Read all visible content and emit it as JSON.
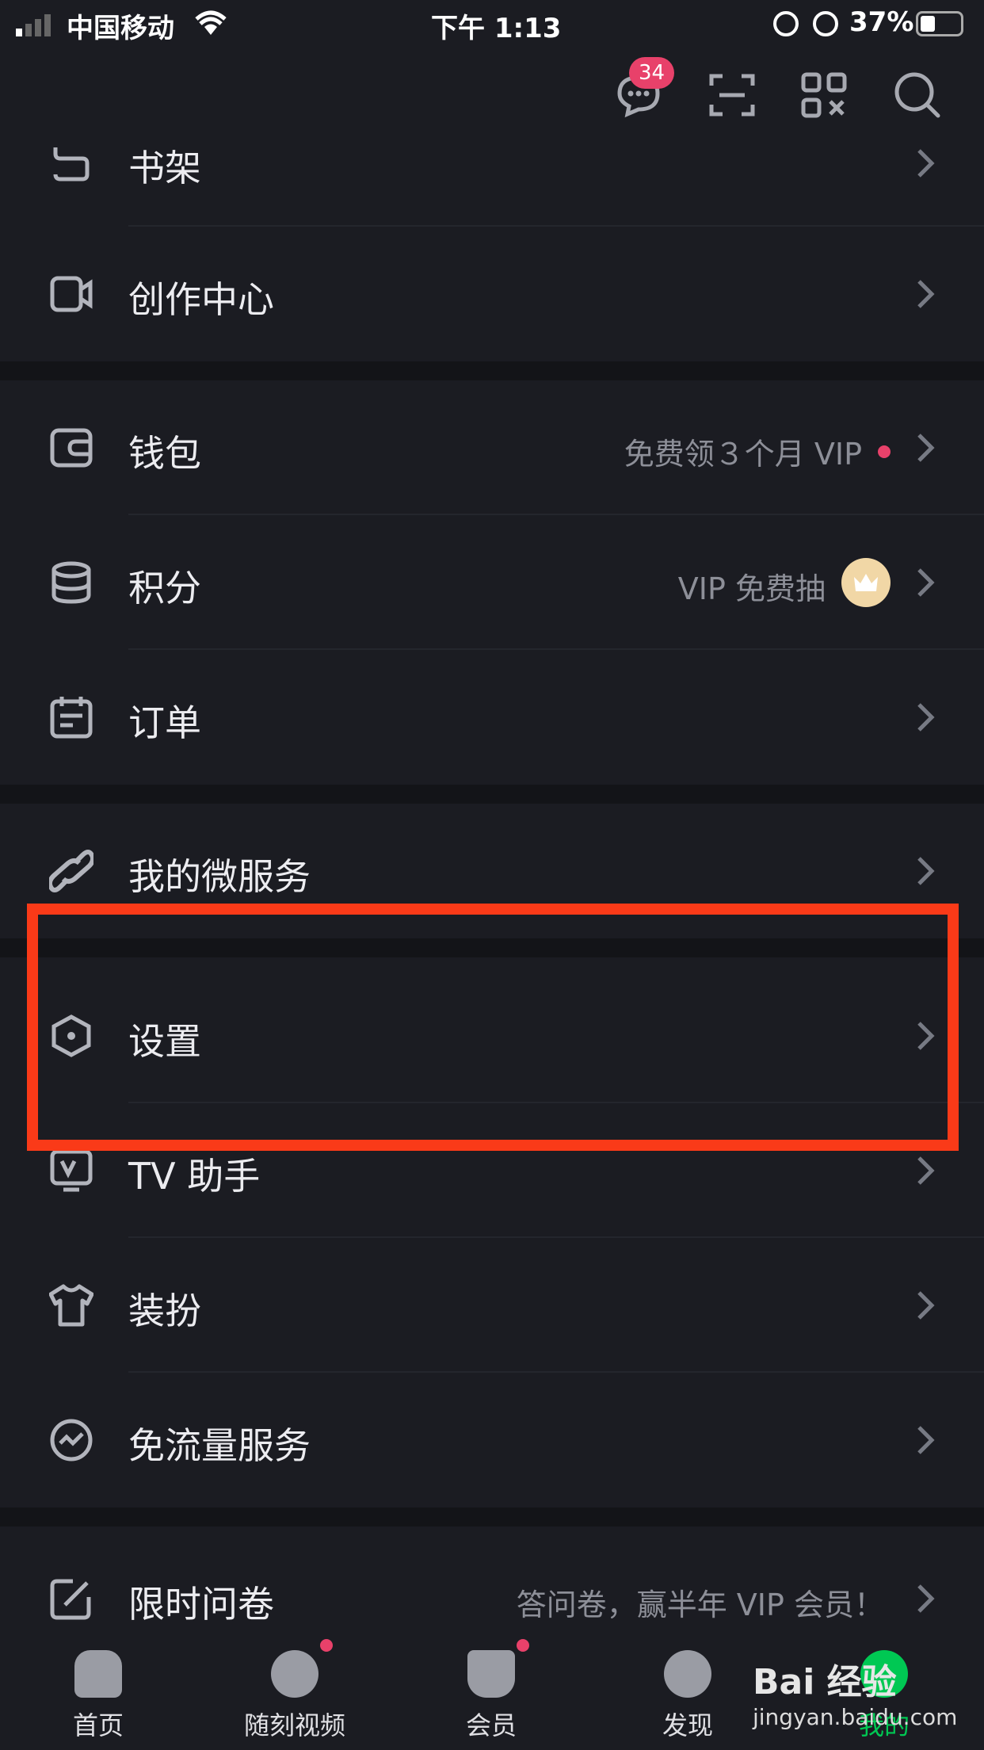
{
  "status_bar": {
    "carrier": "中国移动",
    "time": "下午 1:13",
    "battery": "37%"
  },
  "top_bar": {
    "message_badge": "34",
    "icons": [
      "message-icon",
      "scan-icon",
      "qrcode-icon",
      "search-icon"
    ]
  },
  "menu": {
    "bookshelf": "书架",
    "creator": "创作中心",
    "wallet": "钱包",
    "wallet_sub": "免费领３个月 VIP",
    "points": "积分",
    "points_sub": "VIP 免费抽",
    "orders": "订单",
    "micro": "我的微服务",
    "settings": "设置",
    "tv": "TV 助手",
    "dress": "装扮",
    "free_data": "免流量服务",
    "survey": "限时问卷",
    "survey_sub": "答问卷，赢半年 VIP 会员！"
  },
  "nav": {
    "home": "首页",
    "video": "随刻视频",
    "vip": "会员",
    "discover": "发现",
    "mine": "我的"
  },
  "watermark": {
    "brand": "Bai 经验",
    "url": "jingyan.baidu.com"
  },
  "colors": {
    "background": "#1b1c22",
    "highlight": "#fa3a18",
    "badge": "#e8416a",
    "active_tab": "#00c853"
  }
}
